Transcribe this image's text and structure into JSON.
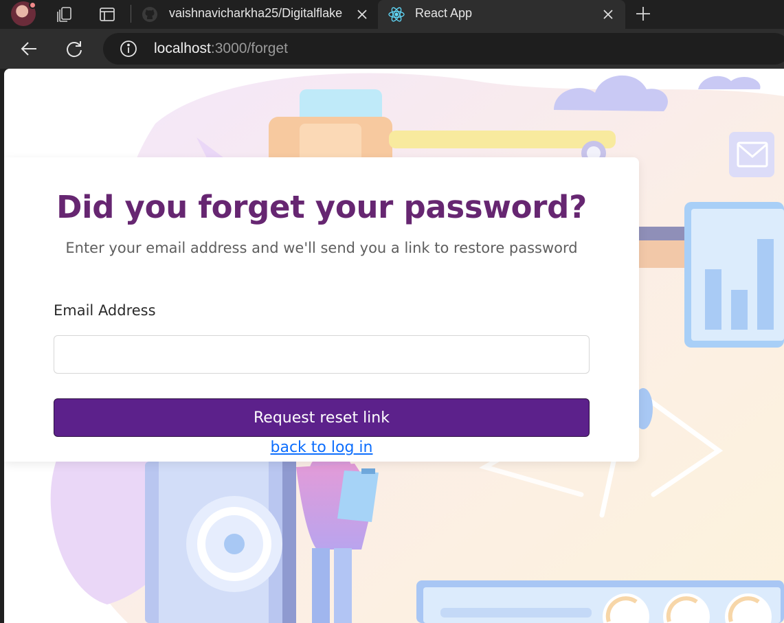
{
  "browser": {
    "tabs": [
      {
        "title": "vaishnavicharkha25/Digitalflake",
        "icon": "github-icon",
        "active": false
      },
      {
        "title": "React App",
        "icon": "react-icon",
        "active": true
      }
    ],
    "address": {
      "host": "localhost",
      "path": ":3000/forget"
    }
  },
  "page": {
    "heading": "Did you forget your password?",
    "subheading": "Enter your email address and we'll send you a link to restore password",
    "email_label": "Email Address",
    "email_value": "",
    "submit_label": "Request reset link",
    "back_link": "back to log in"
  },
  "colors": {
    "heading": "#662671",
    "button": "#5c218b",
    "link": "#0d6efd"
  }
}
